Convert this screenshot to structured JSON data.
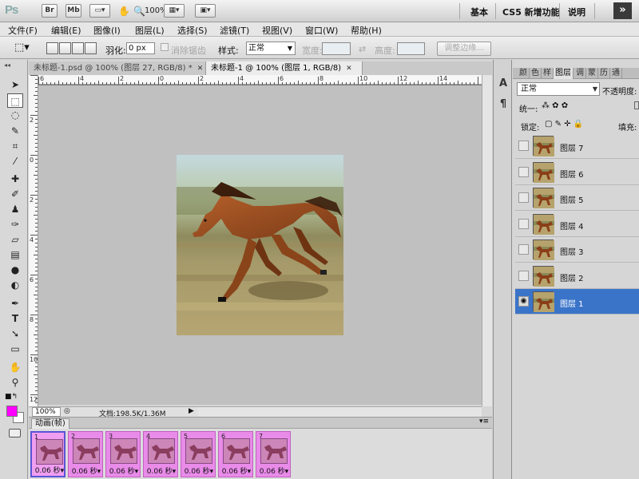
{
  "appbar": {
    "logo": "Ps",
    "br_label": "Br",
    "mb_label": "Mb",
    "zoom": "100%",
    "essentials": "基本",
    "cs5_new": "CS5 新增功能",
    "explain": "说明",
    "more_icon": "double-chevron-icon"
  },
  "menu": {
    "items": [
      "文件(F)",
      "编辑(E)",
      "图像(I)",
      "图层(L)",
      "选择(S)",
      "滤镜(T)",
      "视图(V)",
      "窗口(W)",
      "帮助(H)"
    ]
  },
  "options": {
    "feather_label": "羽化:",
    "feather_value": "0 px",
    "antialias_label": "消除锯齿",
    "style_label": "样式:",
    "style_value": "正常",
    "width_label": "宽度:",
    "height_label": "高度:",
    "refine_button": "调整边缘..."
  },
  "tabs": [
    {
      "label": "未标题-1.psd @ 100% (图层 27, RGB/8) *"
    },
    {
      "label": "未标题-1 @ 100% (图层 1, RGB/8)"
    }
  ],
  "ruler": {
    "top": [
      "6",
      "4",
      "2",
      "0",
      "2",
      "4",
      "6",
      "8",
      "10",
      "12",
      "14"
    ],
    "left": [
      "2",
      "0",
      "2",
      "4",
      "6",
      "8",
      "10",
      "12"
    ]
  },
  "status": {
    "zoom": "100%",
    "doc_info": "文档:198.5K/1.36M"
  },
  "animation": {
    "title": "动画(帧)",
    "frames": [
      {
        "num": "1",
        "delay": "0.06 秒▾"
      },
      {
        "num": "2",
        "delay": "0.06 秒▾"
      },
      {
        "num": "3",
        "delay": "0.06 秒▾"
      },
      {
        "num": "4",
        "delay": "0.06 秒▾"
      },
      {
        "num": "5",
        "delay": "0.06 秒▾"
      },
      {
        "num": "6",
        "delay": "0.06 秒▾"
      },
      {
        "num": "7",
        "delay": "0.06 秒▾"
      }
    ]
  },
  "layers_panel": {
    "tabs": [
      "颜",
      "色",
      "样",
      "图层",
      "调",
      "蒙",
      "历",
      "通"
    ],
    "blend_mode": "正常",
    "opacity_label": "不透明度:",
    "unify_label": "统一:",
    "lock_label": "锁定:",
    "fill_label": "填充:",
    "layers": [
      {
        "name": "图层 7",
        "visible": false,
        "selected": false
      },
      {
        "name": "图层 6",
        "visible": false,
        "selected": false
      },
      {
        "name": "图层 5",
        "visible": false,
        "selected": false
      },
      {
        "name": "图层 4",
        "visible": false,
        "selected": false
      },
      {
        "name": "图层 3",
        "visible": false,
        "selected": false
      },
      {
        "name": "图层 2",
        "visible": false,
        "selected": false
      },
      {
        "name": "图层 1",
        "visible": true,
        "selected": true
      }
    ]
  },
  "colors": {
    "foreground": "#ff00ff",
    "background": "#ffffff",
    "selection": "#3a74c9",
    "frame": "#e98be9"
  }
}
